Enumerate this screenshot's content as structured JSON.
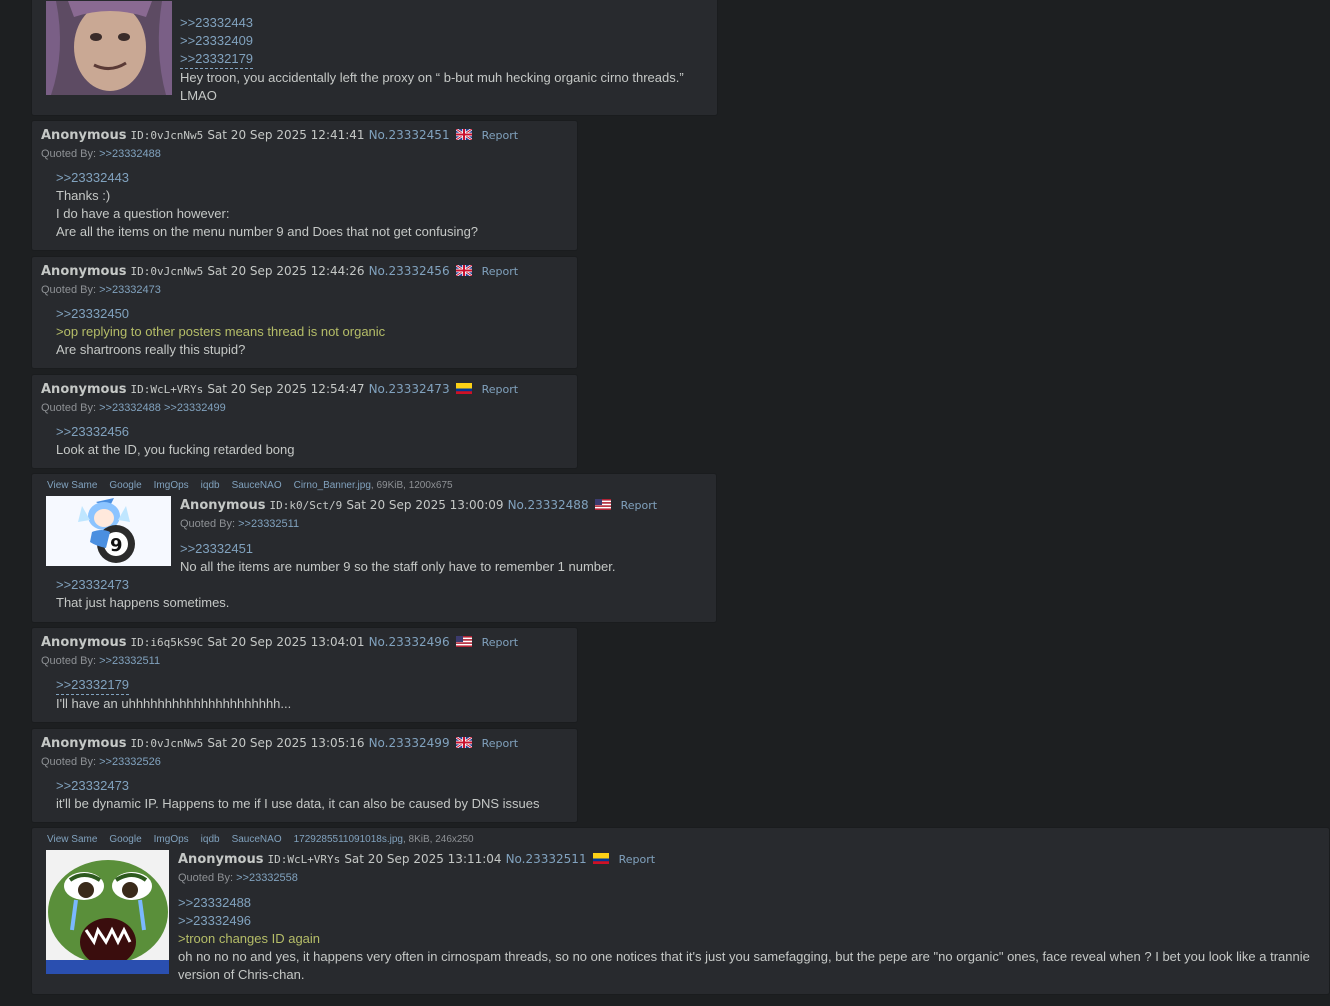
{
  "labels": {
    "quoted_by": "Quoted By:",
    "report": "Report"
  },
  "file_links": [
    "View Same",
    "Google",
    "ImgOps",
    "iqdb",
    "SauceNAO"
  ],
  "posts": [
    {
      "id": "top",
      "lines": [
        ">>23332443",
        ">>23332409",
        ">>23332179"
      ],
      "text": "Hey troon, you accidentally left the proxy on “ b-but muh hecking organic cirno threads.”",
      "text2": "LMAO"
    },
    {
      "name": "Anonymous",
      "uid": "ID:0vJcnNw5",
      "date": "Sat 20 Sep 2025 12:41:41",
      "no": "No.23332451",
      "flag": "uk",
      "quoted_by": [
        ">>23332488"
      ],
      "lines": [
        ">>23332443",
        "Thanks :)",
        "I do have a question however:",
        "Are all the items on the menu number 9 and Does that not get confusing?"
      ]
    },
    {
      "name": "Anonymous",
      "uid": "ID:0vJcnNw5",
      "date": "Sat 20 Sep 2025 12:44:26",
      "no": "No.23332456",
      "flag": "uk",
      "quoted_by": [
        ">>23332473"
      ],
      "lines": [
        ">>23332450",
        ">op replying to other posters means thread is not organic",
        "Are shartroons really this stupid?"
      ]
    },
    {
      "name": "Anonymous",
      "uid": "ID:WcL+VRYs",
      "date": "Sat 20 Sep 2025 12:54:47",
      "no": "No.23332473",
      "flag": "colombia",
      "quoted_by": [
        ">>23332488",
        ">>23332499"
      ],
      "lines": [
        ">>23332456",
        "Look at the ID, you fucking retarded bong"
      ]
    },
    {
      "name": "Anonymous",
      "uid": "ID:k0/Sct/9",
      "date": "Sat 20 Sep 2025 13:00:09",
      "no": "No.23332488",
      "flag": "us",
      "file": {
        "name": "Cirno_Banner.jpg",
        "meta": ", 69KiB, 1200x675"
      },
      "quoted_by": [
        ">>23332511"
      ],
      "lines": [
        ">>23332451",
        "No all the items are number 9 so the staff only have to remember 1 number.",
        ">>23332473",
        "That just happens sometimes."
      ]
    },
    {
      "name": "Anonymous",
      "uid": "ID:i6q5kS9C",
      "date": "Sat 20 Sep 2025 13:04:01",
      "no": "No.23332496",
      "flag": "us",
      "quoted_by": [
        ">>23332511"
      ],
      "lines": [
        ">>23332179",
        "I'll have an uhhhhhhhhhhhhhhhhhhhhh..."
      ]
    },
    {
      "name": "Anonymous",
      "uid": "ID:0vJcnNw5",
      "date": "Sat 20 Sep 2025 13:05:16",
      "no": "No.23332499",
      "flag": "uk",
      "quoted_by": [
        ">>23332526"
      ],
      "lines": [
        ">>23332473",
        "it'll be dynamic IP. Happens to me if I use data, it can also be caused by DNS issues"
      ]
    },
    {
      "name": "Anonymous",
      "uid": "ID:WcL+VRYs",
      "date": "Sat 20 Sep 2025 13:11:04",
      "no": "No.23332511",
      "flag": "colombia",
      "file": {
        "name": "1729285511091018s.jpg",
        "meta": ", 8KiB, 246x250"
      },
      "quoted_by": [
        ">>23332558"
      ],
      "lines": [
        ">>23332488",
        ">>23332496",
        ">troon changes ID again",
        "oh no no no and yes, it happens very often in cirnospam threads, so no one notices that it's just you samefagging, but the pepe are \"no organic\" ones, face reveal when ? I bet you look like a trannie",
        "version of Chris-chan."
      ]
    }
  ]
}
